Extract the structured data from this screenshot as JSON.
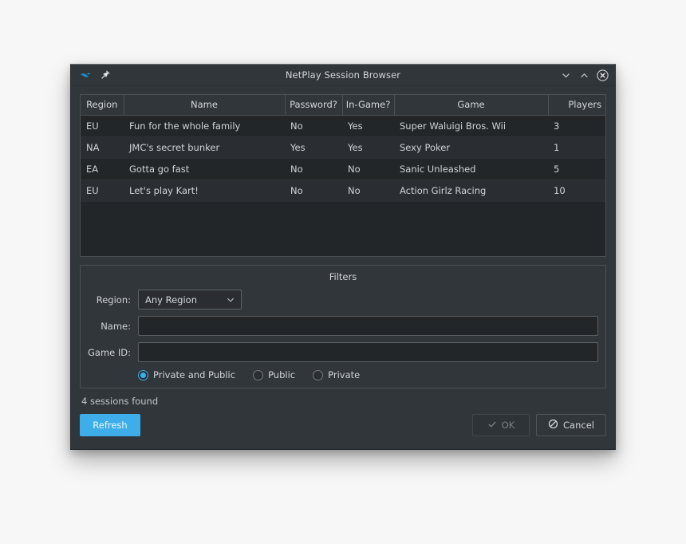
{
  "window": {
    "title": "NetPlay Session Browser",
    "app_icon": "dolphin-icon",
    "pin_icon": "pin-icon",
    "minimize_icon": "chevron-down-icon",
    "maximize_icon": "chevron-up-icon",
    "close_icon": "close-circle-icon"
  },
  "table": {
    "columns": [
      "Region",
      "Name",
      "Password?",
      "In-Game?",
      "Game",
      "Players"
    ],
    "rows": [
      {
        "region": "EU",
        "name": "Fun for the whole family",
        "password": "No",
        "in_game": "Yes",
        "game": "Super Waluigi Bros. Wii",
        "players": "3"
      },
      {
        "region": "NA",
        "name": "JMC's secret bunker",
        "password": "Yes",
        "in_game": "Yes",
        "game": "Sexy Poker",
        "players": "1"
      },
      {
        "region": "EA",
        "name": "Gotta go fast",
        "password": "No",
        "in_game": "No",
        "game": "Sanic Unleashed",
        "players": "5"
      },
      {
        "region": "EU",
        "name": "Let's play Kart!",
        "password": "No",
        "in_game": "No",
        "game": "Action Girlz Racing",
        "players": "10"
      }
    ]
  },
  "filters": {
    "title": "Filters",
    "region_label": "Region:",
    "region_value": "Any Region",
    "region_options": [
      "Any Region"
    ],
    "region_chevron_icon": "chevron-down-icon",
    "name_label": "Name:",
    "name_value": "",
    "name_placeholder": "",
    "game_id_label": "Game ID:",
    "game_id_value": "",
    "game_id_placeholder": "",
    "visibility_options": [
      {
        "label": "Private and Public",
        "checked": true
      },
      {
        "label": "Public",
        "checked": false
      },
      {
        "label": "Private",
        "checked": false
      }
    ]
  },
  "footer": {
    "status": "4 sessions found",
    "refresh_label": "Refresh",
    "ok_label": "OK",
    "ok_icon": "check-icon",
    "ok_disabled": true,
    "cancel_label": "Cancel",
    "cancel_icon": "no-entry-icon"
  },
  "colors": {
    "accent": "#3daee9",
    "window_bg": "#31363b",
    "view_bg": "#232629",
    "alt_row_bg": "#2a2e32",
    "border": "#4b5157",
    "text": "#d0d4d7",
    "disabled_text": "#7b8086"
  }
}
